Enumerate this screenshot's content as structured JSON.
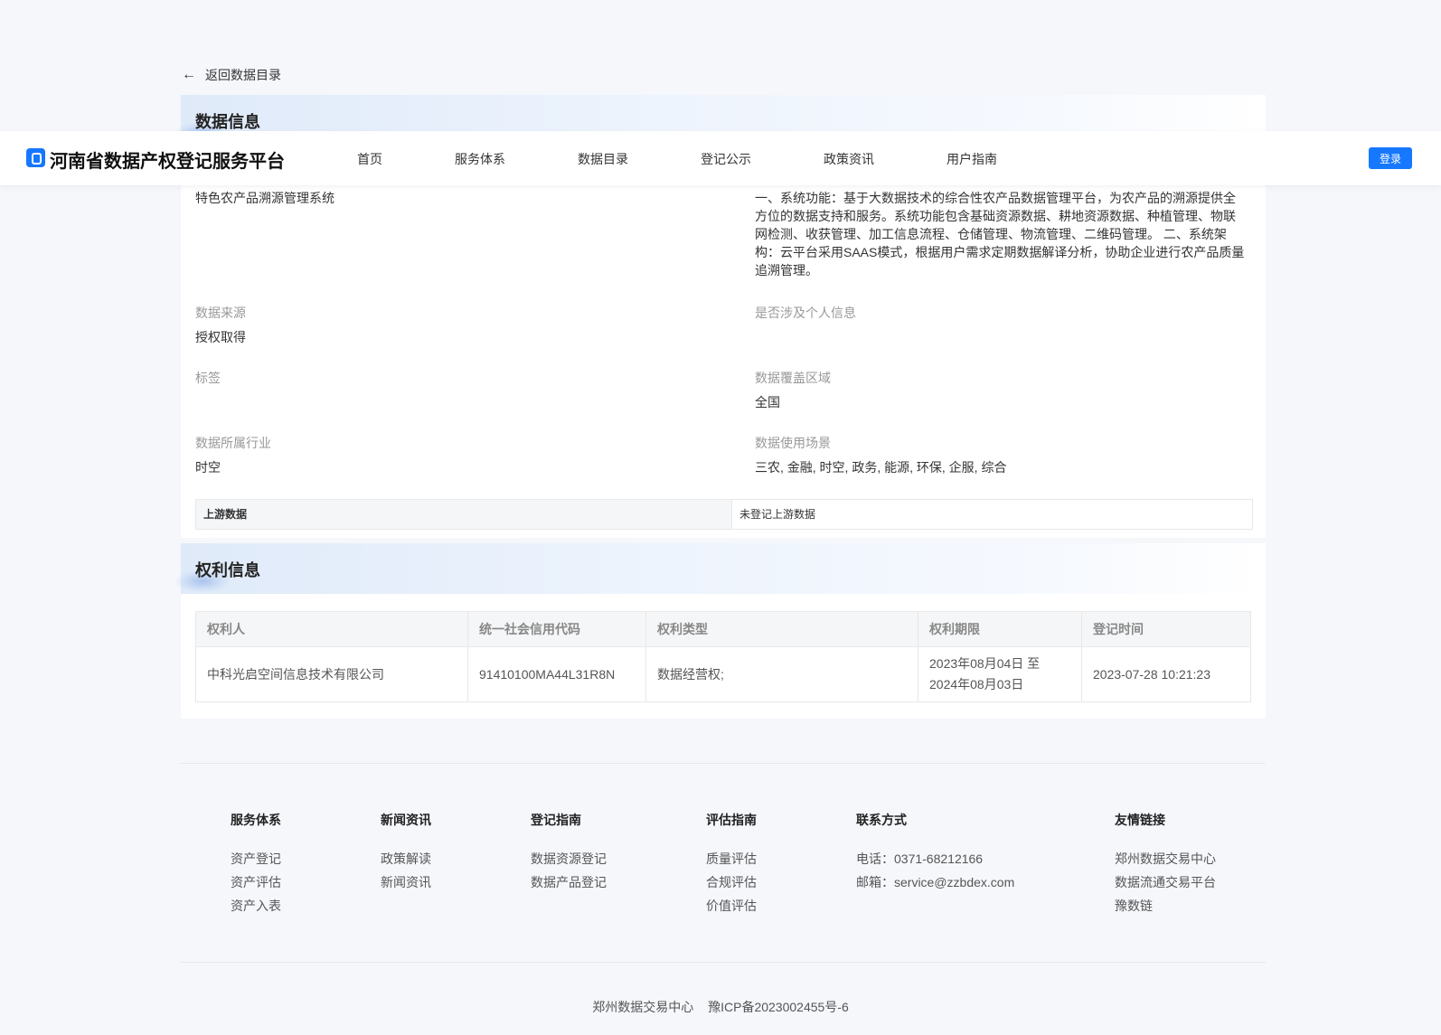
{
  "back": {
    "label": "返回数据目录"
  },
  "header": {
    "brand": "河南省数据产权登记服务平台",
    "nav": [
      "首页",
      "服务体系",
      "数据目录",
      "登记公示",
      "政策资讯",
      "用户指南"
    ],
    "login": "登录"
  },
  "data_info": {
    "title": "数据信息",
    "name": "特色农产品溯源管理系统",
    "description": "一、系统功能：基于大数据技术的综合性农产品数据管理平台，为农产品的溯源提供全方位的数据支持和服务。系统功能包含基础资源数据、耕地资源数据、种植管理、物联网检测、收获管理、加工信息流程、仓储管理、物流管理、二维码管理。 二、系统架构：云平台采用SAAS模式，根据用户需求定期数据解译分析，协助企业进行农产品质量追溯管理。",
    "source_label": "数据来源",
    "source_value": "授权取得",
    "personal_label": "是否涉及个人信息",
    "personal_value": "",
    "tag_label": "标签",
    "tag_value": "",
    "coverage_label": "数据覆盖区域",
    "coverage_value": "全国",
    "industry_label": "数据所属行业",
    "industry_value": "时空",
    "scenario_label": "数据使用场景",
    "scenario_value": "三农, 金融, 时空, 政务, 能源, 环保, 企服, 综合",
    "upstream_label": "上游数据",
    "upstream_value": "未登记上游数据"
  },
  "rights_info": {
    "title": "权利信息",
    "columns": [
      "权利人",
      "统一社会信用代码",
      "权利类型",
      "权利期限",
      "登记时间"
    ],
    "rows": [
      [
        "中科光启空间信息技术有限公司",
        "91410100MA44L31R8N",
        "数据经营权;",
        "2023年08月04日 至 2024年08月03日",
        "2023-07-28 10:21:23"
      ]
    ]
  },
  "footer": {
    "columns": [
      {
        "title": "服务体系",
        "items": [
          "资产登记",
          "资产评估",
          "资产入表"
        ]
      },
      {
        "title": "新闻资讯",
        "items": [
          "政策解读",
          "新闻资讯"
        ]
      },
      {
        "title": "登记指南",
        "items": [
          "数据资源登记",
          "数据产品登记"
        ]
      },
      {
        "title": "评估指南",
        "items": [
          "质量评估",
          "合规评估",
          "价值评估"
        ]
      },
      {
        "title": "联系方式",
        "items": [
          "电话：0371-68212166",
          "邮箱：service@zzbdex.com"
        ]
      },
      {
        "title": "友情链接",
        "items": [
          "郑州数据交易中心",
          "数据流通交易平台",
          "豫数链"
        ]
      }
    ],
    "org": "郑州数据交易中心",
    "icp": "豫ICP备2023002455号-6"
  },
  "colors": {
    "accent": "#1677ff",
    "background": "#f5f7fb"
  }
}
